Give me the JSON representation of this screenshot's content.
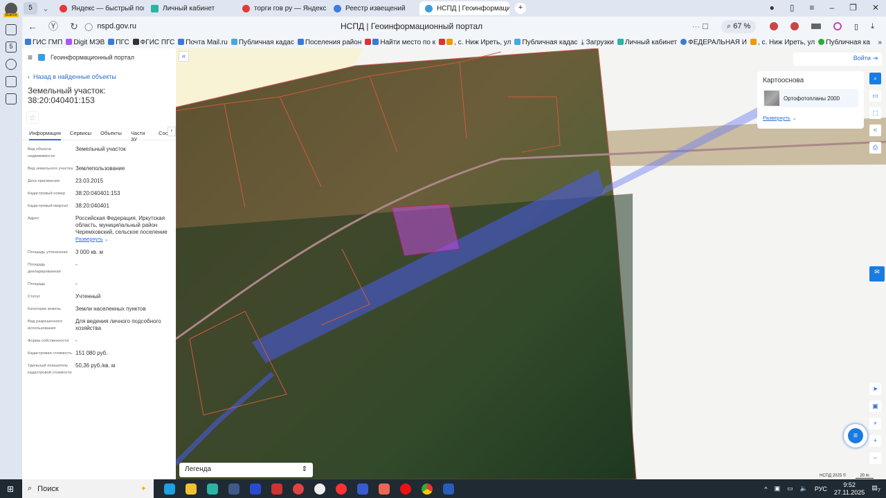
{
  "browser": {
    "login_label": "Войти",
    "tab_count": "5",
    "tabs": [
      {
        "label": "Яндекс — быстрый поиск",
        "color": "#e53935"
      },
      {
        "label": "Личный кабинет",
        "color": "#2bb3a3"
      },
      {
        "label": "торги гов ру — Яндекс: н",
        "color": "#e53935"
      },
      {
        "label": "Реестр извещений",
        "color": "#3b7de0"
      },
      {
        "label": "НСПД | Геоинформацио",
        "color": "#3b9de0",
        "active": true
      }
    ],
    "url": "nspd.gov.ru",
    "page_title": "НСПД | Геоинформационный портал",
    "zoom": "67 %",
    "bookmarks": [
      "ГИС ГМП",
      "Digit МЭВ",
      "ПГС",
      "ФГИС ПГС",
      "Почта Mail.ru",
      "Публичная кадас",
      "Поселения район",
      "Найти место по к",
      ", с. Ниж Иреть, ул",
      "Публичная кадас",
      "Загрузки",
      "Личный кабинет",
      "ФЕДЕРАЛЬНАЯ И",
      ", с. Ниж Иреть, ул",
      "Публичная ка"
    ]
  },
  "sidebar": {
    "portal_name": "Геоинформационный портал",
    "back_label": "Назад в найденные объекты",
    "title": "Земельный участок: 38:20:040401:153",
    "tabs": [
      "Информация",
      "Сервисы",
      "Объекты",
      "Части ЗУ",
      "Состав"
    ],
    "fields": [
      {
        "label": "Вид объекта недвижимости",
        "value": "Земельный участок"
      },
      {
        "label": "Вид земельного участка",
        "value": "Землепользование"
      },
      {
        "label": "Дата присвоения",
        "value": "23.03.2015"
      },
      {
        "label": "Кадастровый номер",
        "value": "38:20:040401:153"
      },
      {
        "label": "Кадастровый квартал",
        "value": "38:20:040401"
      },
      {
        "label": "Адрес",
        "value": "Российская Федерация, Иркутская область, муниципальный район Черемховский, сельское поселение"
      },
      {
        "label": "Площадь уточненная",
        "value": "3 000 кв. м"
      },
      {
        "label": "Площадь декларированная",
        "value": "-"
      },
      {
        "label": "Площадь",
        "value": "-"
      },
      {
        "label": "Статус",
        "value": "Учтенный"
      },
      {
        "label": "Категория земель",
        "value": "Земли населенных пунктов"
      },
      {
        "label": "Вид разрешенного использования",
        "value": "Для ведения личного подсобного хозяйства"
      },
      {
        "label": "Форма собственности",
        "value": "-"
      },
      {
        "label": "Кадастровая стоимость",
        "value": "151 080 руб."
      },
      {
        "label": "Удельный показатель кадастровой стоимости",
        "value": "50,36 руб./кв. м"
      }
    ],
    "expand_label": "Развернуть"
  },
  "map": {
    "login_label": "Войти",
    "basemap_title": "Картооснова",
    "basemap_item": "Ортофотопланы 2000",
    "expand_label": "Развернуть",
    "legend_label": "Легенда",
    "copyright": "НСПД 2025 ©",
    "scale": "20 m"
  },
  "taskbar": {
    "search_placeholder": "Поиск",
    "lang": "РУС",
    "time": "9:52",
    "date": "27.11.2025",
    "notifications": "7"
  }
}
